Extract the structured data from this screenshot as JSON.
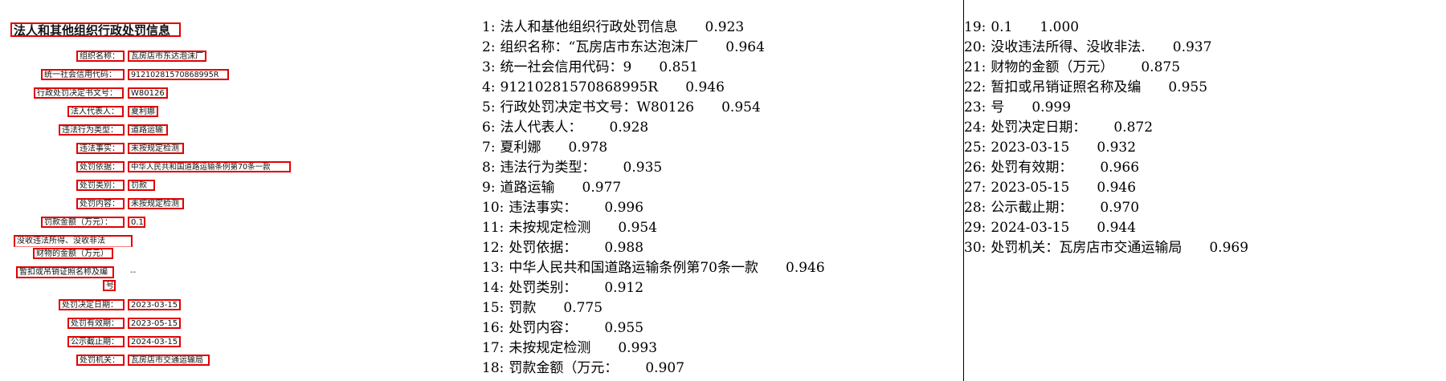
{
  "doc": {
    "title": "法人和其他组织行政处罚信息",
    "fields": [
      {
        "id": "org-name",
        "label": "组织名称：",
        "value": "瓦房店市东达泡沫厂"
      },
      {
        "id": "credit-code",
        "label": "统一社会信用代码：",
        "value": "91210281570868995R"
      },
      {
        "id": "decision-no",
        "label": "行政处罚决定书文号：",
        "value": "W80126"
      },
      {
        "id": "legal-rep",
        "label": "法人代表人：",
        "value": "夏利娜"
      },
      {
        "id": "violation-type",
        "label": "违法行为类型：",
        "value": "道路运输"
      },
      {
        "id": "violation-fact",
        "label": "违法事实：",
        "value": "未按规定检测"
      },
      {
        "id": "penalty-basis",
        "label": "处罚依据：",
        "value": "中华人民共和国道路运输条例第70条一款"
      },
      {
        "id": "penalty-category",
        "label": "处罚类别：",
        "value": "罚款"
      },
      {
        "id": "penalty-content",
        "label": "处罚内容：",
        "value": "未按规定检测"
      },
      {
        "id": "fine-amount",
        "label": "罚款金额（万元）：",
        "value": "0.1"
      },
      {
        "id": "confiscation-1",
        "label": "没收违法所得、没收非法",
        "value": ""
      },
      {
        "id": "confiscation-2",
        "label": "财物的金额（万元）",
        "value": ""
      },
      {
        "id": "license-1",
        "label": "暂扣或吊销证照名称及编",
        "value": "--"
      },
      {
        "id": "license-2",
        "label": "号",
        "value": ""
      },
      {
        "id": "decision-date",
        "label": "处罚决定日期：",
        "value": "2023-03-15"
      },
      {
        "id": "valid-until",
        "label": "处罚有效期：",
        "value": "2023-05-15"
      },
      {
        "id": "publish-until",
        "label": "公示截止期：",
        "value": "2024-03-15"
      },
      {
        "id": "authority",
        "label": "处罚机关：",
        "value": "瓦房店市交通运输局"
      }
    ]
  },
  "results": [
    {
      "n": "1:",
      "text": "法人和基他组织行政处罚信息",
      "score": "0.923"
    },
    {
      "n": "2:",
      "text": "组织名称：“瓦房店市东达泡沫厂",
      "score": "0.964"
    },
    {
      "n": "3:",
      "text": "统一社会信用代码：9",
      "score": "0.851"
    },
    {
      "n": "4:",
      "text": "91210281570868995R",
      "score": "0.946"
    },
    {
      "n": "5:",
      "text": "行政处罚决定书文号：W80126",
      "score": "0.954"
    },
    {
      "n": "6:",
      "text": "法人代表人：",
      "score": "0.928"
    },
    {
      "n": "7:",
      "text": "夏利娜",
      "score": "0.978"
    },
    {
      "n": "8:",
      "text": "违法行为类型：",
      "score": "0.935"
    },
    {
      "n": "9:",
      "text": "道路运输",
      "score": "0.977"
    },
    {
      "n": "10:",
      "text": "违法事实：",
      "score": "0.996"
    },
    {
      "n": "11:",
      "text": "未按规定检测",
      "score": "0.954"
    },
    {
      "n": "12:",
      "text": "处罚依据：",
      "score": "0.988"
    },
    {
      "n": "13:",
      "text": "中华人民共和国道路运输条例第70条一款",
      "score": "0.946"
    },
    {
      "n": "14:",
      "text": "处罚类别：",
      "score": "0.912"
    },
    {
      "n": "15:",
      "text": "罚款",
      "score": "0.775"
    },
    {
      "n": "16:",
      "text": "处罚内容：",
      "score": "0.955"
    },
    {
      "n": "17:",
      "text": "未按规定检测",
      "score": "0.993"
    },
    {
      "n": "18:",
      "text": "罚款金额（万元：",
      "score": "0.907"
    },
    {
      "n": "19:",
      "text": "0.1",
      "score": "1.000"
    },
    {
      "n": "20:",
      "text": "没收违法所得、没收非法.",
      "score": "0.937"
    },
    {
      "n": "21:",
      "text": "财物的金额（万元）",
      "score": "0.875"
    },
    {
      "n": "22:",
      "text": "暂扣或吊销证照名称及编",
      "score": "0.955"
    },
    {
      "n": "23:",
      "text": "号",
      "score": "0.999"
    },
    {
      "n": "24:",
      "text": "处罚决定日期：",
      "score": "0.872"
    },
    {
      "n": "25:",
      "text": "2023-03-15",
      "score": "0.932"
    },
    {
      "n": "26:",
      "text": "处罚有效期：",
      "score": "0.966"
    },
    {
      "n": "27:",
      "text": "2023-05-15",
      "score": "0.946"
    },
    {
      "n": "28:",
      "text": "公示截止期：",
      "score": "0.970"
    },
    {
      "n": "29:",
      "text": "2024-03-15",
      "score": "0.944"
    },
    {
      "n": "30:",
      "text": "处罚机关：瓦房店市交通运输局",
      "score": "0.969"
    }
  ]
}
